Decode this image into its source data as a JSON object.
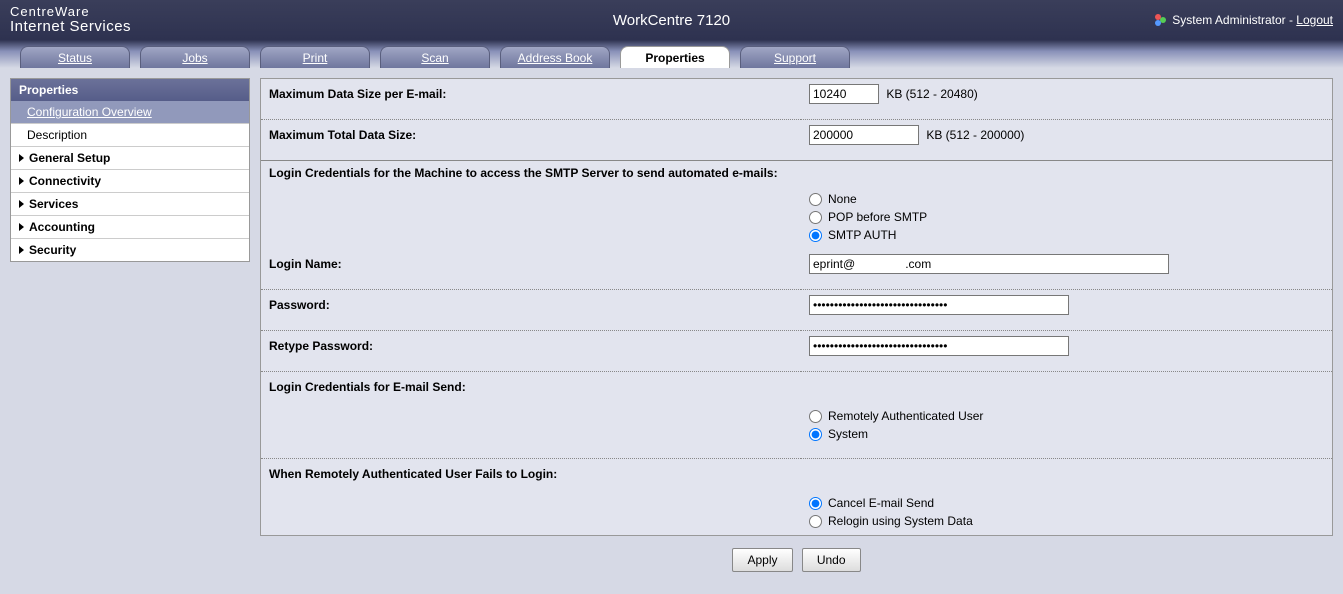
{
  "brand": {
    "line1": "CentreWare",
    "line2": "Internet Services"
  },
  "product_title": "WorkCentre 7120",
  "user": {
    "role": "System Administrator",
    "logout": "Logout"
  },
  "tabs": [
    {
      "label": "Status"
    },
    {
      "label": "Jobs"
    },
    {
      "label": "Print"
    },
    {
      "label": "Scan"
    },
    {
      "label": "Address Book"
    },
    {
      "label": "Properties"
    },
    {
      "label": "Support"
    }
  ],
  "sidebar": {
    "header": "Properties",
    "sub": "Configuration Overview",
    "item": "Description",
    "cats": [
      "General Setup",
      "Connectivity",
      "Services",
      "Accounting",
      "Security"
    ]
  },
  "form": {
    "max_per_email_label": "Maximum Data Size per E-mail:",
    "max_per_email_value": "10240",
    "max_per_email_suffix": "KB (512 - 20480)",
    "max_total_label": "Maximum Total Data Size:",
    "max_total_value": "200000",
    "max_total_suffix": "KB (512 - 200000)",
    "cred_section": "Login Credentials for the Machine to access the SMTP Server to send automated e-mails:",
    "cred_opts": {
      "none": "None",
      "pop": "POP before SMTP",
      "smtp": "SMTP AUTH"
    },
    "login_label": "Login Name:",
    "login_value": "eprint@               .com",
    "pw_label": "Password:",
    "pw_value": "••••••••••••••••••••••••••••••••",
    "rpw_label": "Retype Password:",
    "rpw_value": "••••••••••••••••••••••••••••••••",
    "send_section": "Login Credentials for E-mail Send:",
    "send_opts": {
      "remote": "Remotely Authenticated User",
      "system": "System"
    },
    "fail_section": "When Remotely Authenticated User Fails to Login:",
    "fail_opts": {
      "cancel": "Cancel E-mail Send",
      "relogin": "Relogin using System Data"
    }
  },
  "buttons": {
    "apply": "Apply",
    "undo": "Undo"
  }
}
